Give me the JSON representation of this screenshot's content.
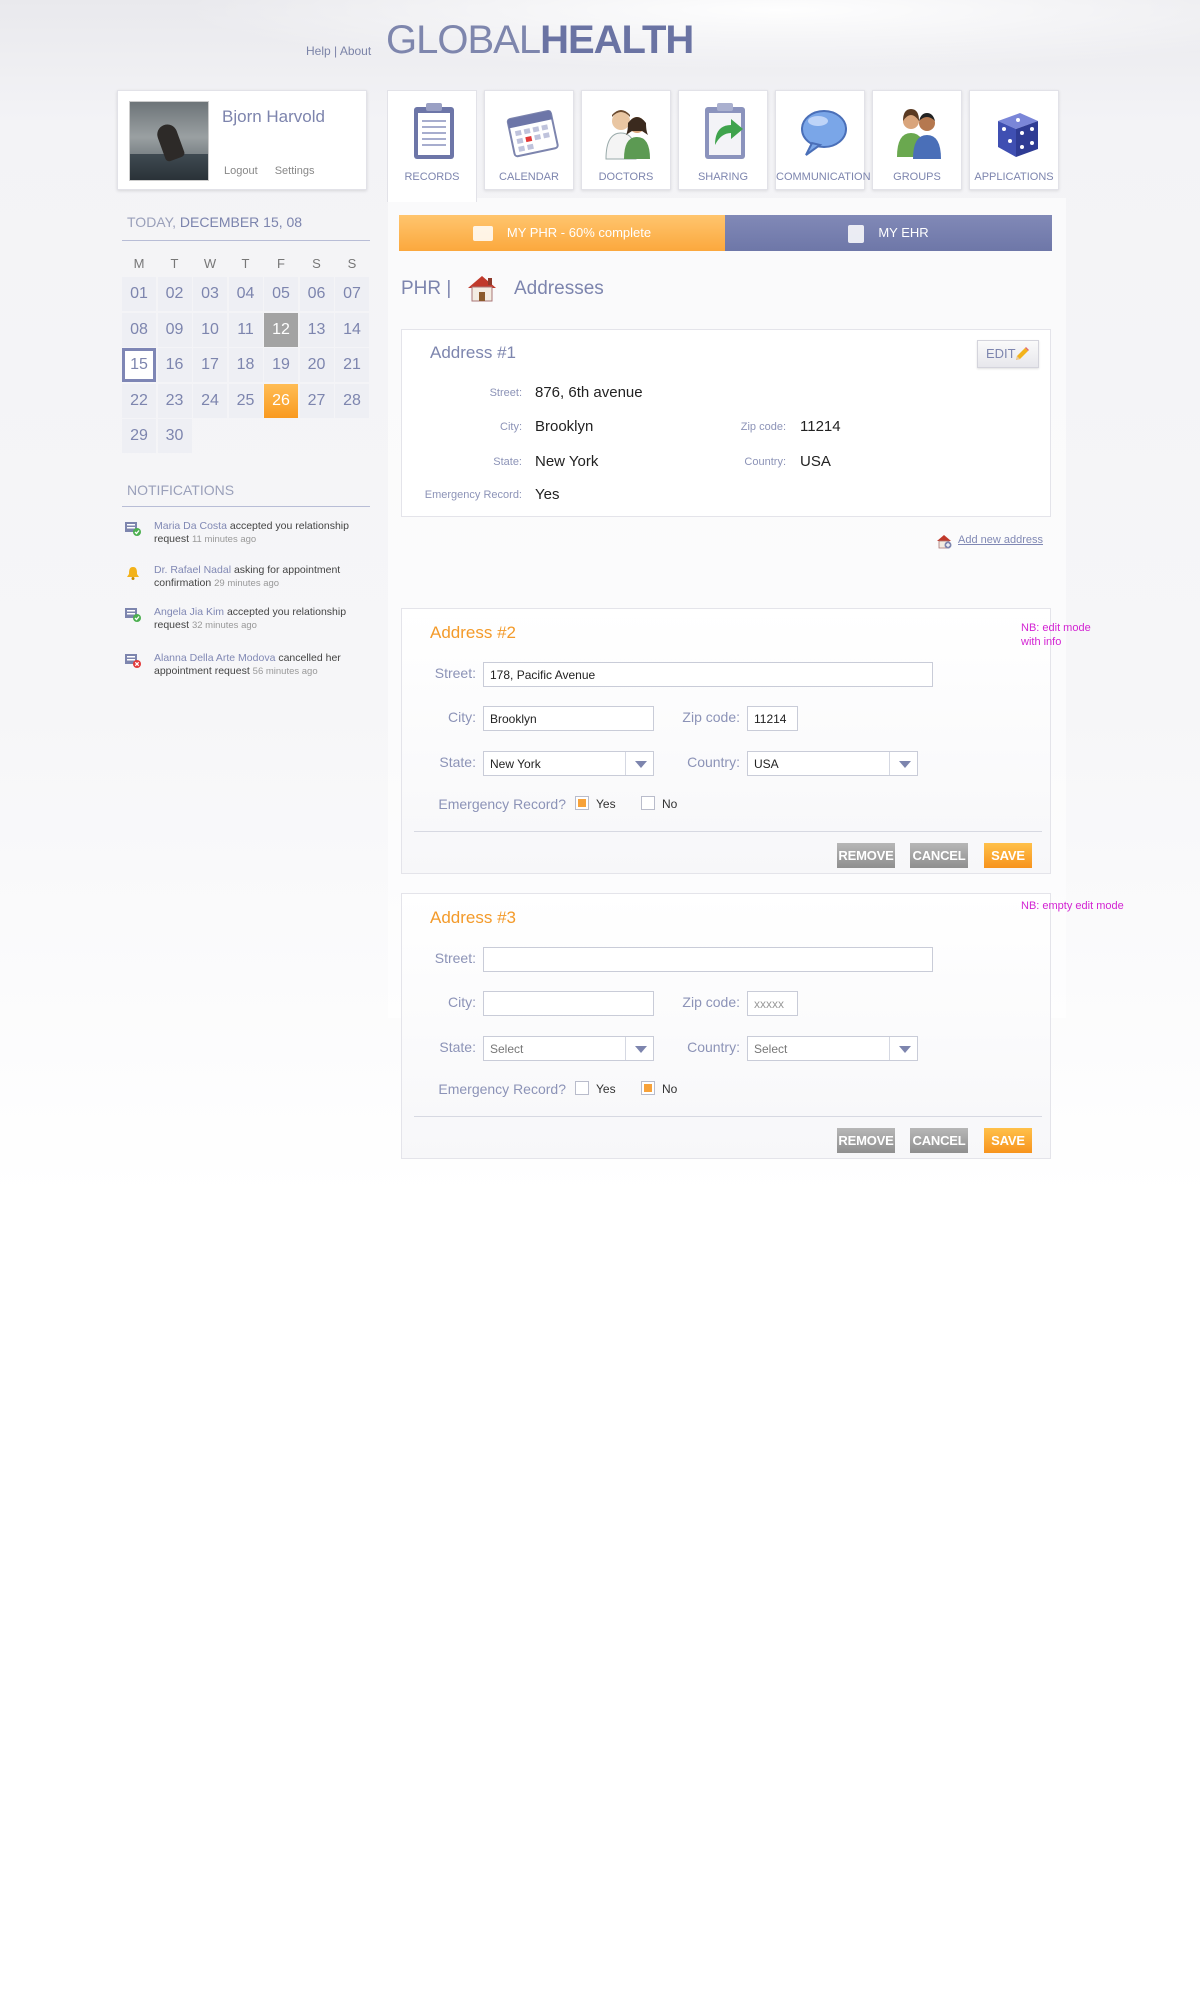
{
  "header": {
    "help": "Help",
    "sep": "|",
    "about": "About",
    "logo_light": "GLOBAL",
    "logo_bold": "HEALTH"
  },
  "profile": {
    "name": "Bjorn Harvold",
    "logout": "Logout",
    "settings": "Settings"
  },
  "date": {
    "today_label": "TODAY,",
    "today_value": "DECEMBER 15, 08"
  },
  "calendar": {
    "weekdays": [
      "M",
      "T",
      "W",
      "T",
      "F",
      "S",
      "S"
    ],
    "days": [
      "01",
      "02",
      "03",
      "04",
      "05",
      "06",
      "07",
      "08",
      "09",
      "10",
      "11",
      "12",
      "13",
      "14",
      "15",
      "16",
      "17",
      "18",
      "19",
      "20",
      "21",
      "22",
      "23",
      "24",
      "25",
      "26",
      "27",
      "28",
      "29",
      "30"
    ],
    "selected": "15",
    "highlight_gray": "12",
    "highlight_orange": "26"
  },
  "notifications": {
    "title": "NOTIFICATIONS",
    "items": [
      {
        "who": "Maria Da Costa",
        "text": "accepted you relationship request",
        "ago": "11 minutes ago"
      },
      {
        "who": "Dr. Rafael Nadal",
        "text": "asking for appointment confirmation",
        "ago": "29 minutes ago"
      },
      {
        "who": "Angela Jia Kim",
        "text": "accepted you relationship request",
        "ago": "32 minutes ago"
      },
      {
        "who": "Alanna Della Arte Modova",
        "text": "cancelled her appointment request",
        "ago": "56 minutes ago"
      }
    ]
  },
  "tabs": [
    {
      "label": "RECORDS",
      "icon": "clipboard-icon"
    },
    {
      "label": "CALENDAR",
      "icon": "calendar-icon"
    },
    {
      "label": "DOCTORS",
      "icon": "doctors-icon"
    },
    {
      "label": "SHARING",
      "icon": "sharing-icon"
    },
    {
      "label": "COMMUNICATION",
      "icon": "speech-bubble-icon"
    },
    {
      "label": "GROUPS",
      "icon": "group-icon"
    },
    {
      "label": "APPLICATIONS",
      "icon": "dice-icon"
    }
  ],
  "record_bar": {
    "phr": "MY PHR  -  60% complete",
    "phr_progress": 0.6,
    "ehr": "MY EHR"
  },
  "breadcrumb": {
    "section": "PHR |",
    "page": "Addresses"
  },
  "address1": {
    "title": "Address #1",
    "edit": "EDIT",
    "street_label": "Street:",
    "street": "876, 6th avenue",
    "city_label": "City:",
    "city": "Brooklyn",
    "zip_label": "Zip code:",
    "zip": "11214",
    "state_label": "State:",
    "state": "New York",
    "country_label": "Country:",
    "country": "USA",
    "emergency_label": "Emergency Record:",
    "emergency": "Yes"
  },
  "add_new": "Add new address",
  "address2": {
    "title": "Address #2",
    "street_label": "Street:",
    "street": "178, Pacific Avenue",
    "city_label": "City:",
    "city": "Brooklyn",
    "zip_label": "Zip code:",
    "zip": "11214",
    "state_label": "State:",
    "state": "New York",
    "country_label": "Country:",
    "country": "USA",
    "emergency_label": "Emergency Record?",
    "yes": "Yes",
    "no": "No",
    "emergency_checked": "yes",
    "remove": "REMOVE",
    "cancel": "CANCEL",
    "save": "SAVE"
  },
  "address3": {
    "title": "Address #3",
    "street_label": "Street:",
    "city_label": "City:",
    "zip_label": "Zip code:",
    "zip_placeholder": "xxxxx",
    "state_label": "State:",
    "state": "Select",
    "country_label": "Country:",
    "country": "Select",
    "emergency_label": "Emergency Record?",
    "yes": "Yes",
    "no": "No",
    "emergency_checked": "no",
    "remove": "REMOVE",
    "cancel": "CANCEL",
    "save": "SAVE"
  },
  "notes": {
    "edit_mode_line1": "NB: edit mode",
    "edit_mode_line2": "with info",
    "empty_mode": "NB: empty edit mode"
  },
  "colors": {
    "accent_blue": "#7d85ae",
    "accent_orange": "#f7a23a",
    "note_magenta": "#d324d3"
  }
}
